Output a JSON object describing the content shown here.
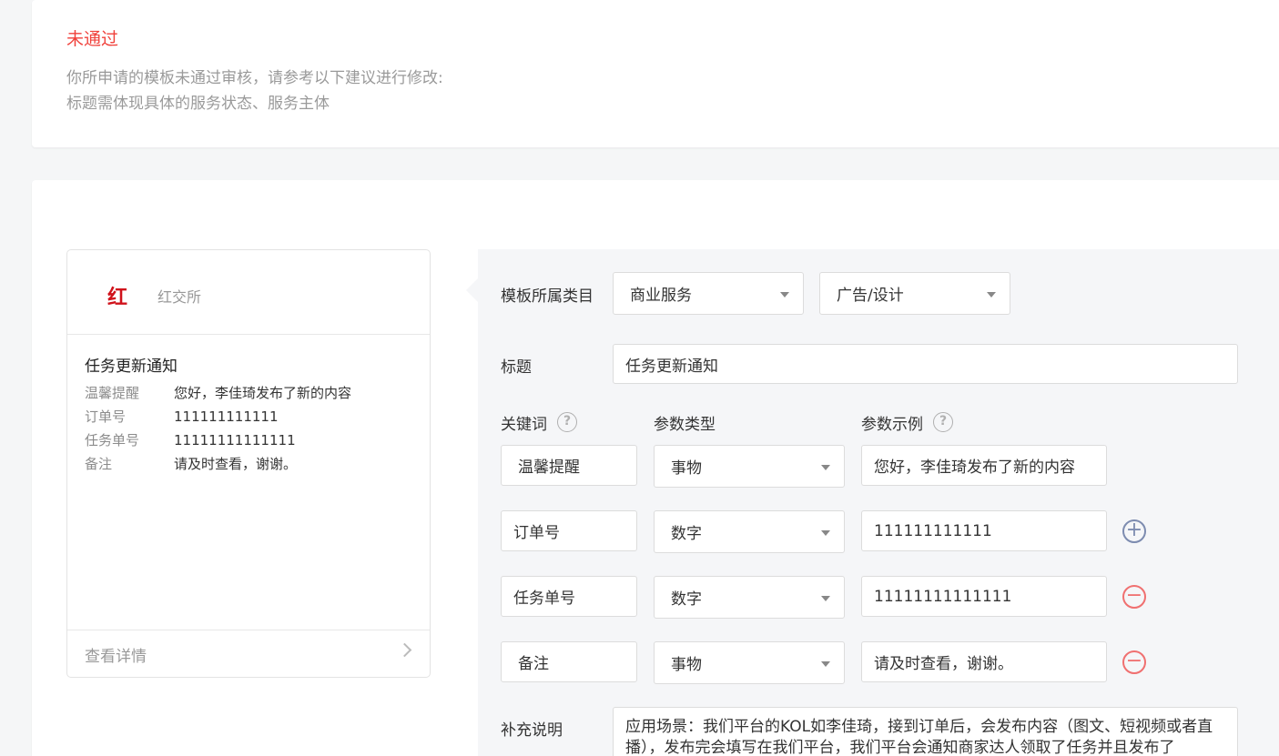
{
  "review": {
    "status": "未通过",
    "message": "你所申请的模板未通过审核，请参考以下建议进行修改:",
    "suggestion": "标题需体现具体的服务状态、服务主体"
  },
  "preview": {
    "logo_char": "红",
    "app_name": "红交所",
    "title": "任务更新通知",
    "rows": [
      {
        "key": "温馨提醒",
        "value": "您好，李佳琦发布了新的内容"
      },
      {
        "key": "订单号",
        "value": "111111111111"
      },
      {
        "key": "任务单号",
        "value": "11111111111111"
      },
      {
        "key": "备注",
        "value": "请及时查看，谢谢。"
      }
    ],
    "detail_link": "查看详情"
  },
  "form": {
    "category_label": "模板所属类目",
    "category_primary": "商业服务",
    "category_secondary": "广告/设计",
    "title_label": "标题",
    "title_value": "任务更新通知",
    "col_keyword": "关键词",
    "col_param_type": "参数类型",
    "col_param_example": "参数示例",
    "rows": [
      {
        "keyword": "温馨提醒",
        "type": "事物",
        "example": "您好，李佳琦发布了新的内容"
      },
      {
        "keyword": "订单号",
        "type": "数字",
        "example": "111111111111"
      },
      {
        "keyword": "任务单号",
        "type": "数字",
        "example": "11111111111111"
      },
      {
        "keyword": "备注",
        "type": "事物",
        "example": "请及时查看，谢谢。"
      }
    ],
    "supplement_label": "补充说明",
    "supplement_value": "应用场景：我们平台的KOL如李佳琦，接到订单后，会发布内容（图文、短视频或者直播），发布完会填写在我们平台，我们平台会通知商家达人领取了任务并且发布了"
  },
  "colors": {
    "status_red": "#f0413b",
    "brand_red": "#d0121b",
    "plus_blue": "#7d8cb0",
    "minus_red": "#f07070"
  },
  "icons": {
    "help": "question-circle-icon",
    "add": "plus-circle-icon",
    "remove": "minus-circle-icon",
    "chevron": "chevron-right-icon",
    "dropdown": "caret-down-icon"
  }
}
